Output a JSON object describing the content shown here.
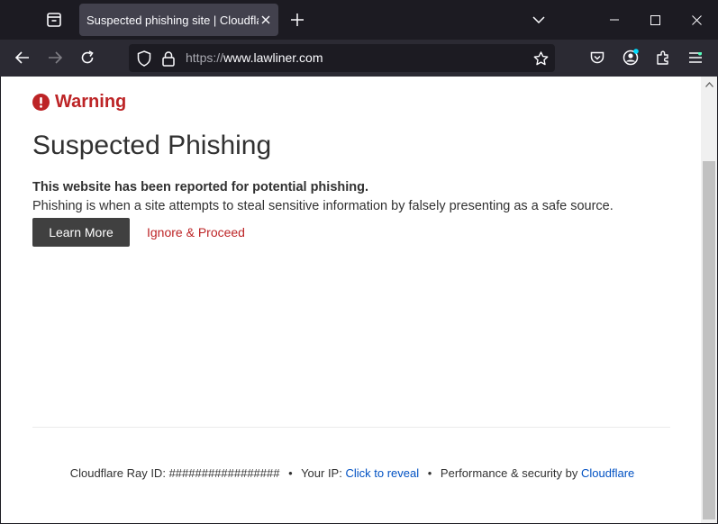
{
  "browser": {
    "tab": {
      "title": "Suspected phishing site | Cloudflare"
    },
    "url": {
      "scheme": "https://",
      "host": "www.lawliner.com"
    },
    "colors": {
      "chrome_dark": "#1c1b22",
      "toolbar": "#2b2a33",
      "tab_active": "#42414d",
      "account_dot": "#00ddff"
    }
  },
  "page": {
    "warning_label": "Warning",
    "heading": "Suspected Phishing",
    "strong_text": "This website has been reported for potential phishing.",
    "body_text": "Phishing is when a site attempts to steal sensitive information by falsely presenting as a safe source.",
    "learn_more_label": "Learn More",
    "ignore_label": "Ignore & Proceed",
    "colors": {
      "warning": "#bd2426",
      "text": "#313131",
      "button": "#404040",
      "link": "#0051c3"
    }
  },
  "footer": {
    "ray_label": "Cloudflare Ray ID:",
    "ray_id": "#################",
    "ip_label": "Your IP:",
    "ip_link": "Click to reveal",
    "perf_label": "Performance & security by",
    "perf_link": "Cloudflare",
    "separator": "•"
  }
}
